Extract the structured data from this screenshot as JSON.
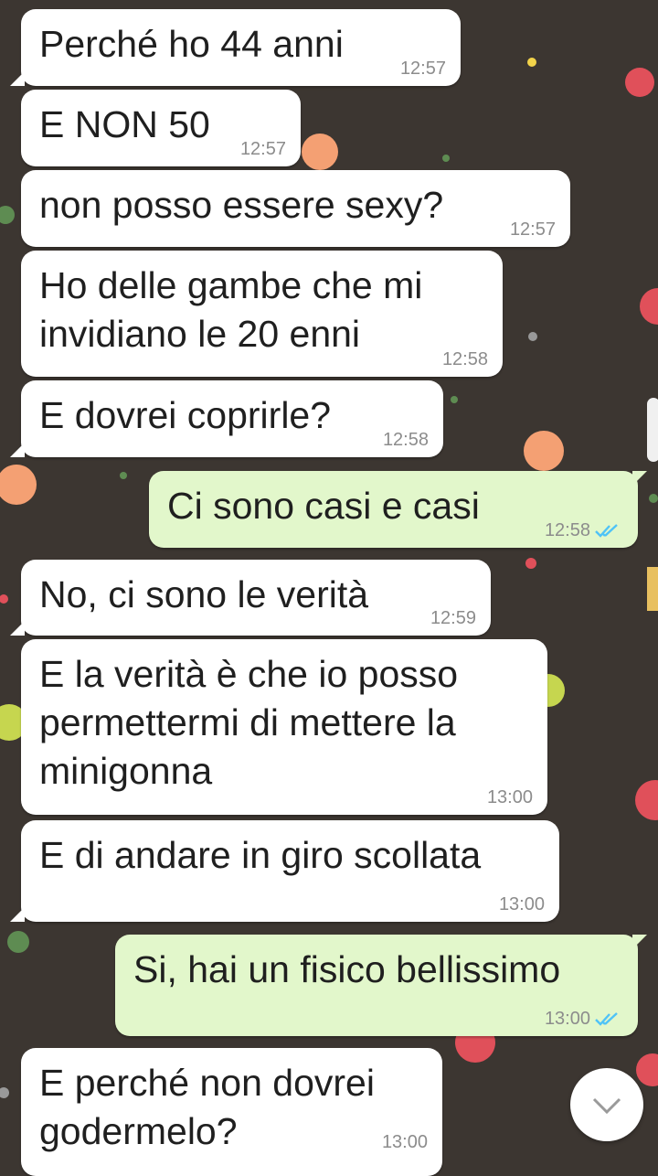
{
  "chat": {
    "messages": [
      {
        "direction": "incoming",
        "text": "Perché ho 44 anni",
        "time": "12:57"
      },
      {
        "direction": "incoming",
        "text": "E NON 50",
        "time": "12:57"
      },
      {
        "direction": "incoming",
        "text": "non posso essere sexy?",
        "time": "12:57"
      },
      {
        "direction": "incoming",
        "lines": [
          "Ho delle gambe che mi",
          "invidiano le 20 enni"
        ],
        "time": "12:58"
      },
      {
        "direction": "incoming",
        "text": "E dovrei coprirle?",
        "time": "12:58"
      },
      {
        "direction": "outgoing",
        "text": "Ci sono casi e casi",
        "time": "12:58",
        "status": "read"
      },
      {
        "direction": "incoming",
        "text": "No, ci sono le verità",
        "time": "12:59"
      },
      {
        "direction": "incoming",
        "lines": [
          "E la verità è che io posso",
          "permettermi di mettere la",
          "minigonna"
        ],
        "time": "13:00"
      },
      {
        "direction": "incoming",
        "text": "E di andare in giro scollata",
        "time": "13:00"
      },
      {
        "direction": "outgoing",
        "text": "Si, hai un fisico bellissimo",
        "time": "13:00",
        "status": "read"
      },
      {
        "direction": "incoming",
        "lines": [
          "E perché non dovrei",
          "godermelo?"
        ],
        "time": "13:00"
      }
    ]
  },
  "colors": {
    "wallpaper": "#3c3631",
    "incoming_bubble": "#ffffff",
    "outgoing_bubble": "#e2f7cb",
    "read_ticks": "#4fc3f7",
    "timestamp": "#8c8c8c"
  },
  "icons": {
    "read_status": "double-check-icon",
    "scroll_down": "chevron-down-icon"
  }
}
